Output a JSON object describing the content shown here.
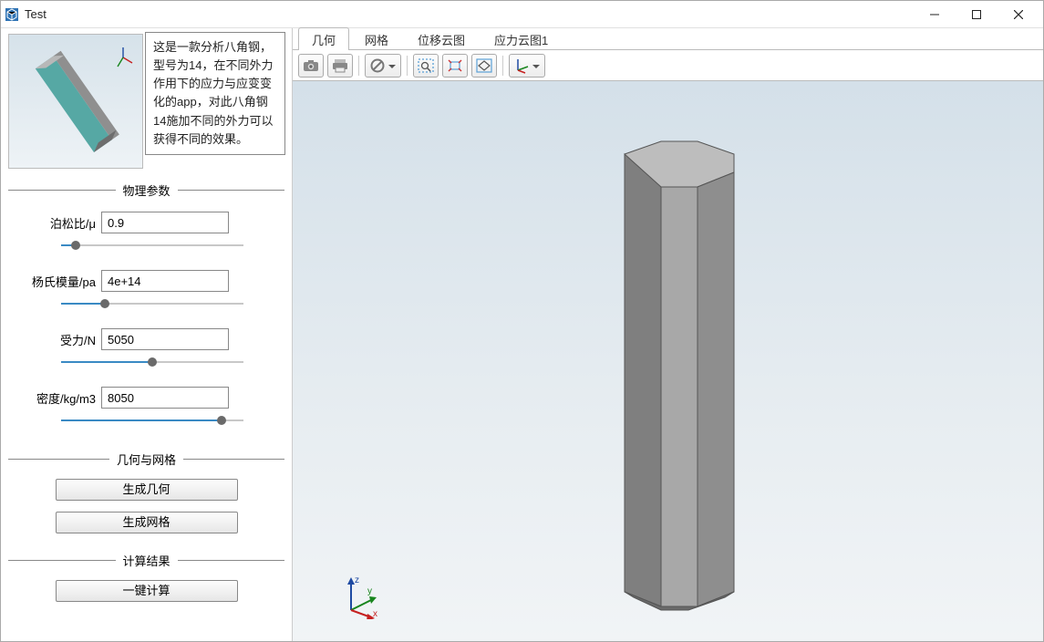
{
  "window": {
    "title": "Test"
  },
  "tooltip": "这是一款分析八角钢，型号为14，在不同外力作用下的应力与应变变化的app，对此八角钢14施加不同的外力可以获得不同的效果。",
  "sections": {
    "physics": "物理参数",
    "geomesh": "几何与网格",
    "result": "计算结果"
  },
  "params": {
    "poisson": {
      "label": "泊松比/μ",
      "value": "0.9",
      "pct": 8
    },
    "young": {
      "label": "杨氏模量/pa",
      "value": "4e+14",
      "pct": 24
    },
    "force": {
      "label": "受力/N",
      "value": "5050",
      "pct": 50
    },
    "density": {
      "label": "密度/kg/m3",
      "value": "8050",
      "pct": 88
    }
  },
  "buttons": {
    "genGeom": "生成几何",
    "genMesh": "生成网格",
    "compute": "一键计算"
  },
  "tabs": [
    "几何",
    "网格",
    "位移云图",
    "应力云图1"
  ],
  "activeTab": 0,
  "triad": {
    "x": "x",
    "y": "y",
    "z": "z"
  }
}
